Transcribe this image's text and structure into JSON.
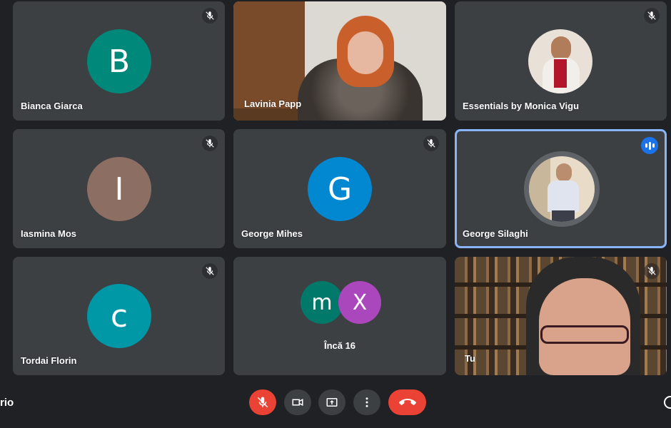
{
  "participants": [
    {
      "name": "Bianca Giarca",
      "initial": "B",
      "color": "#00897b"
    },
    {
      "name": "Lavinia Papp"
    },
    {
      "name": "Essentials by Monica Vigu"
    },
    {
      "name": "Iasmina Mos",
      "initial": "I",
      "color": "#8d6e63"
    },
    {
      "name": "George Mihes",
      "initial": "G",
      "color": "#0288d1"
    },
    {
      "name": "George Silaghi"
    },
    {
      "name": "Tordai Florin",
      "initial": "c",
      "color": "#0097a7"
    },
    {
      "name": "Tu"
    }
  ],
  "more_tile": {
    "label": "Încă 16",
    "avatars": [
      {
        "initial": "m",
        "color": "#00796b"
      },
      {
        "initial": "X",
        "color": "#ab47bc"
      }
    ]
  },
  "bottom_bar": {
    "left_text": "rio"
  },
  "colors": {
    "background": "#202124",
    "tile": "#3c4043",
    "active_border": "#8ab4f8",
    "mic_off_button": "#ea4335",
    "end_call_button": "#ea4335"
  },
  "icons": {
    "mute": "mic-off-icon",
    "speaking": "audio-level-icon",
    "camera": "camera-icon",
    "present": "present-screen-icon",
    "more": "more-vert-icon",
    "hangup": "call-end-icon",
    "info": "info-icon"
  }
}
